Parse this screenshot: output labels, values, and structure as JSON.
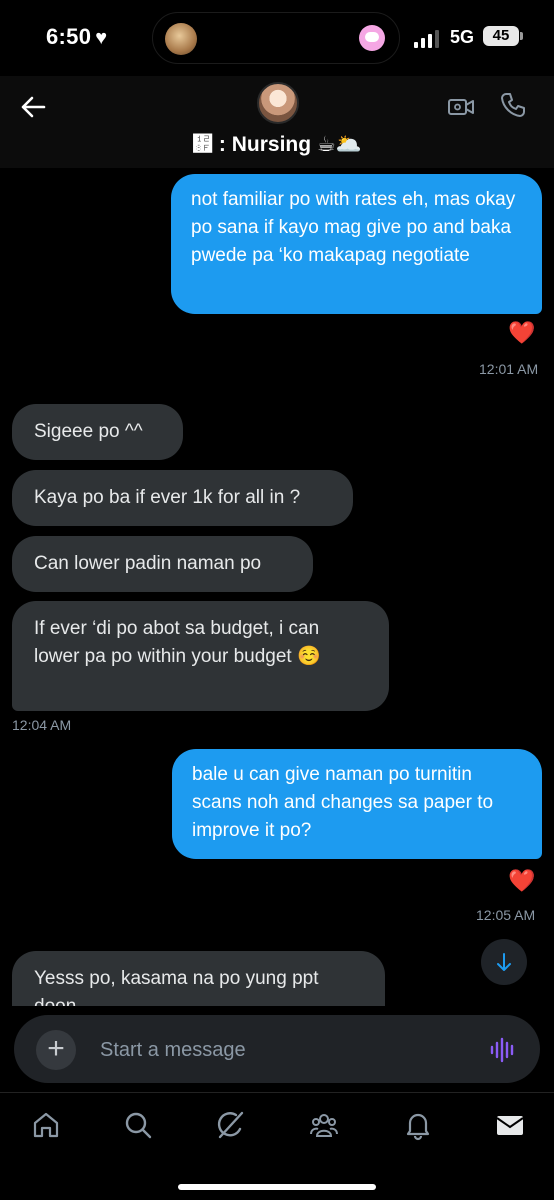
{
  "status_bar": {
    "time": "6:50",
    "network": "5G",
    "battery": "45",
    "signal_bars": 3
  },
  "header": {
    "title": "኏ : Nursing ☕🌥️",
    "icons": [
      "back-arrow-icon",
      "video-call-icon",
      "phone-icon"
    ]
  },
  "messages": [
    {
      "type": "sent",
      "text": "not familiar po with rates eh, mas okay po sana if kayo mag give po and baka pwede pa ‘ko makapag negotiate",
      "reaction": "❤️",
      "time": "12:01 AM"
    },
    {
      "type": "received",
      "text": "Sigeee po ^^"
    },
    {
      "type": "received",
      "text": "Kaya po ba if ever 1k for all in ?"
    },
    {
      "type": "received",
      "text": "Can lower padin naman po"
    },
    {
      "type": "received",
      "text": "If ever ‘di po abot sa budget, i can lower pa po within your budget ☺️",
      "time": "12:04 AM"
    },
    {
      "type": "sent",
      "text": "bale u can give naman po turnitin scans noh and changes sa paper to improve it po?",
      "reaction": "❤️",
      "time": "12:05 AM"
    },
    {
      "type": "received",
      "text": "Yesss po, kasama na po yung ppt doon"
    }
  ],
  "composer": {
    "placeholder": "Start a message"
  },
  "tabs": [
    "home",
    "search",
    "grok",
    "communities",
    "notifications",
    "messages"
  ],
  "colors": {
    "sent_bubble": "#1d9bf0",
    "received_bubble": "#2f3336",
    "voice_icon": "#8b5cf6",
    "reaction_heart": "#e0245e"
  }
}
